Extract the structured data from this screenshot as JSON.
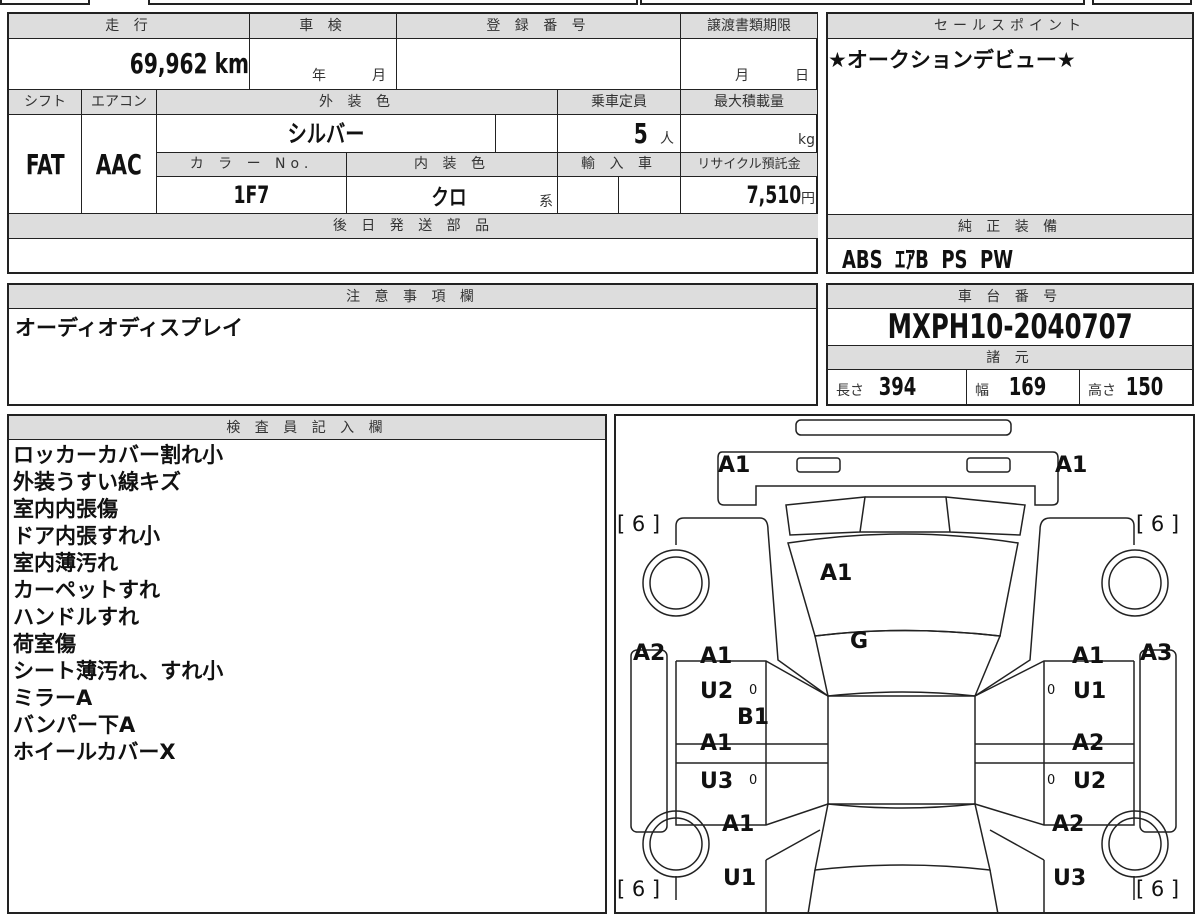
{
  "sheet": {
    "mileage": {
      "header": "走 行",
      "value": "69,962",
      "unit": "km"
    },
    "inspection": {
      "header": "車 検",
      "year_unit": "年",
      "month_unit": "月"
    },
    "registration": {
      "header": "登 録 番 号",
      "value": ""
    },
    "transfer_deadline": {
      "header": "譲渡書類期限",
      "month_unit": "月",
      "day_unit": "日"
    },
    "shift": {
      "header": "シフト",
      "value": "FAT"
    },
    "aircon": {
      "header": "エアコン",
      "value": "AAC"
    },
    "exterior_color": {
      "header": "外 装 色",
      "value": "シルバー"
    },
    "capacity": {
      "header": "乗車定員",
      "value": "5",
      "unit": "人"
    },
    "max_load": {
      "header": "最大積載量",
      "unit": "kg"
    },
    "color_no": {
      "header": "カ ラ ー No.",
      "value": "1F7"
    },
    "interior_color": {
      "header": "内 装 色",
      "value": "クロ",
      "unit": "系"
    },
    "import": {
      "header": "輸 入 車"
    },
    "recycle_fee": {
      "header": "リサイクル預託金",
      "value": "7,510",
      "unit": "円"
    },
    "later_parts": {
      "header": "後 日 発 送 部 品",
      "value": ""
    }
  },
  "sales_point": {
    "header": "セールスポイント",
    "value": "★オークションデビュー★"
  },
  "equipment": {
    "header": "純 正 装 備",
    "value": "ABS  ｴｱB  PS  PW"
  },
  "notes": {
    "header": "注 意 事 項 欄",
    "value": "オーディオディスプレイ"
  },
  "chassis": {
    "header": "車 台 番 号",
    "value": "MXPH10-2040707"
  },
  "specs": {
    "header": "諸 元",
    "length_label": "長さ",
    "length": "394",
    "width_label": "幅",
    "width": "169",
    "height_label": "高さ",
    "height": "150"
  },
  "inspector": {
    "header": "検 査 員 記 入 欄",
    "lines": [
      "ロッカーカバー割れ小",
      "外装うすい線キズ",
      "室内内張傷",
      "ドア内張すれ小",
      "室内薄汚れ",
      "カーペットすれ",
      "ハンドルすれ",
      "荷室傷",
      "シート薄汚れ、すれ小",
      "ミラーA",
      "バンパー下A",
      "ホイールカバーX"
    ]
  },
  "diagram": {
    "marks": [
      "A1",
      "A1",
      "A1",
      "G",
      "A2",
      "A1",
      "U2",
      "B1",
      "A1",
      "U3",
      "A1",
      "U1",
      "A3",
      "A1",
      "U1",
      "A2",
      "U2",
      "A2",
      "U3"
    ],
    "tire_depth": [
      "[ 6 ]",
      "[ 6 ]",
      "[ 6 ]",
      "[ 6 ]"
    ],
    "small_marks": [
      "0",
      "0",
      "0",
      "0"
    ]
  }
}
